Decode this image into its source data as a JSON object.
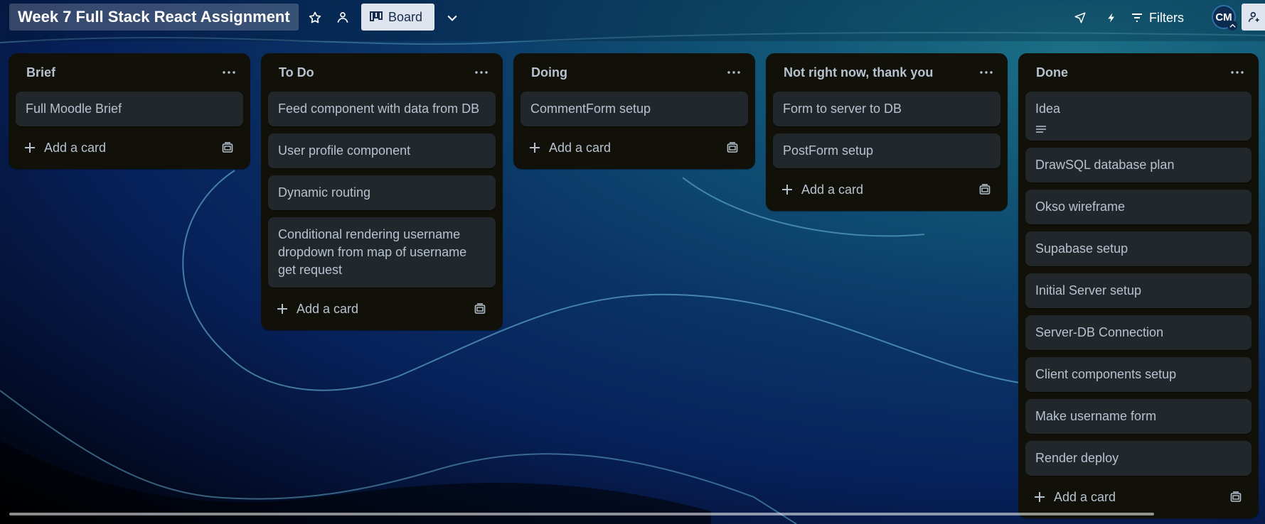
{
  "board": {
    "title": "Week 7 Full Stack React Assignment"
  },
  "header": {
    "view_label": "Board",
    "filters_label": "Filters",
    "avatar_initials": "CM"
  },
  "lists": [
    {
      "title": "Brief",
      "cards": [
        {
          "text": "Full Moodle Brief"
        }
      ],
      "add_label": "Add a card"
    },
    {
      "title": "To Do",
      "cards": [
        {
          "text": "Feed component with data from DB"
        },
        {
          "text": "User profile component"
        },
        {
          "text": "Dynamic routing"
        },
        {
          "text": "Conditional rendering username dropdown from map of username get request"
        }
      ],
      "add_label": "Add a card"
    },
    {
      "title": "Doing",
      "cards": [
        {
          "text": "CommentForm setup"
        }
      ],
      "add_label": "Add a card"
    },
    {
      "title": "Not right now, thank you",
      "cards": [
        {
          "text": "Form to server to DB"
        },
        {
          "text": "PostForm setup"
        }
      ],
      "add_label": "Add a card"
    },
    {
      "title": "Done",
      "cards": [
        {
          "text": "Idea",
          "has_description": true
        },
        {
          "text": "DrawSQL database plan"
        },
        {
          "text": "Okso wireframe"
        },
        {
          "text": "Supabase setup"
        },
        {
          "text": "Initial Server setup"
        },
        {
          "text": "Server-DB Connection"
        },
        {
          "text": "Client components setup"
        },
        {
          "text": "Make username form"
        },
        {
          "text": "Render deploy"
        }
      ],
      "add_label": "Add a card"
    }
  ]
}
